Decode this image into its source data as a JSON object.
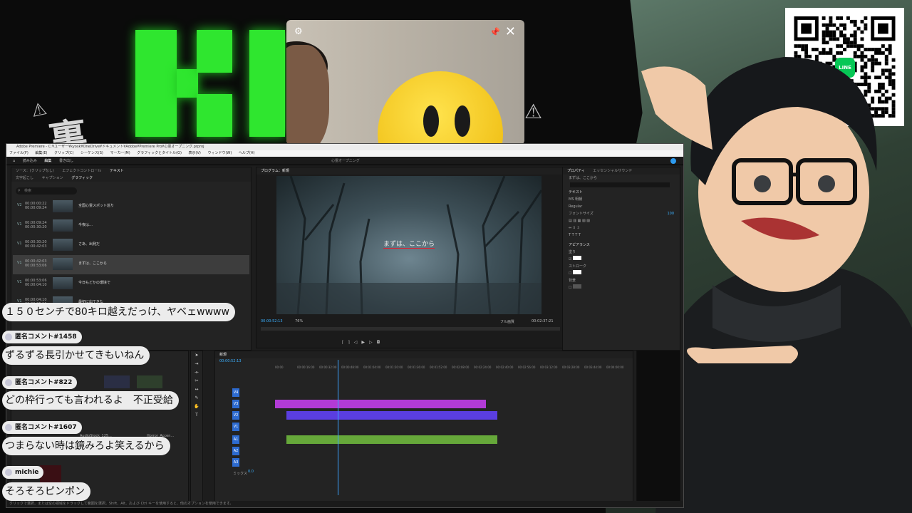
{
  "stream": {
    "green_logo_text": "KI",
    "kanji_text": "裏",
    "warning_glyph": "⚠",
    "qr_badge": "LINE"
  },
  "webcam": {
    "gear_icon": "gear-icon",
    "pin_icon": "pin-icon",
    "close_icon": "close-icon"
  },
  "premiere": {
    "title": "Adobe Premiere - C:¥ユーザー¥kyosk¥OneDrive¥ドキュメント¥Adobe¥Premiere Pro¥心霊オープニング.prproj",
    "menu": [
      "ファイル(F)",
      "編集(E)",
      "クリップ(C)",
      "シーケンス(S)",
      "マーカー(M)",
      "グラフィックとタイトル(G)",
      "表示(V)",
      "ウィンドウ(W)",
      "ヘルプ(H)"
    ],
    "workspace_tabs": [
      "読み込み",
      "編集",
      "書き出し"
    ],
    "sequence_title": "心霊オープニング",
    "left_tabs": [
      "ソース：(クリップなし)",
      "エフェクトコントロール",
      "テキスト"
    ],
    "left_subtabs": [
      "文字起こし",
      "キャプション",
      "グラフィック"
    ],
    "search_placeholder": "検索",
    "captions": [
      {
        "track": "V2",
        "tin": "00:00:00:22",
        "tout": "00:00:09:24",
        "text": "全国心霊スポット巡り"
      },
      {
        "track": "V1",
        "tin": "00:00:09:24",
        "tout": "00:00:30:20",
        "text": "今夜は…"
      },
      {
        "track": "V1",
        "tin": "00:00:30:20",
        "tout": "00:00:42:03",
        "text": "さあ、出発だ"
      },
      {
        "track": "V1",
        "tin": "00:00:42:03",
        "tout": "00:00:53:06",
        "text": "まずは、ここから"
      },
      {
        "track": "V1",
        "tin": "00:00:53:06",
        "tout": "00:00:04:10",
        "text": "今日もどかの環境で"
      },
      {
        "track": "V1",
        "tin": "00:00:04:10",
        "tout": "00:00:26:11",
        "text": "最初に出てきた"
      }
    ],
    "program": {
      "tab": "プログラム：新規",
      "caption": "まずは、ここから",
      "timecode": "00:00:52:13",
      "zoom": "76%",
      "quality": "フル画質",
      "duration": "00:02:37:21"
    },
    "properties": {
      "tabs": [
        "プロパティ",
        "エッセンシャルサウンド"
      ],
      "clip_name": "まずは、ここから",
      "section_text": "テキスト",
      "font": "MS 明朝",
      "style": "Regular",
      "size_label": "フォントサイズ",
      "size_value": "100",
      "section_appearance": "アピアランス",
      "fill": "塗り",
      "stroke": "ストローク",
      "shadow": "背景"
    },
    "timeline": {
      "tab": "新規",
      "timecode": "00:00:52:13",
      "ruler": [
        "00:00",
        "00:00:16:00",
        "00:00:32:00",
        "00:00:48:00",
        "00:01:04:00",
        "00:01:20:00",
        "00:01:36:00",
        "00:01:52:00",
        "00:02:08:00",
        "00:02:24:00",
        "00:02:40:00",
        "00:02:56:00",
        "00:03:12:00",
        "00:03:28:00",
        "00:03:44:00",
        "00:04:00:00"
      ],
      "tracks": [
        "V4",
        "V3",
        "V2",
        "V1",
        "A1",
        "A2",
        "A3",
        "ミックス"
      ],
      "mix_value": "0.0"
    },
    "project_items": [
      "AudioStock_125...",
      "Horror_Accen..."
    ],
    "status": "クリックで選択、または空の領域をドラッグして範囲を選択。Shift、Alt、および Ctrl キーを使用すると、他のオプションを使用できます。"
  },
  "chat": [
    {
      "type": "msg",
      "text": "１５０センチで80キロ越えだっけ、ヤベェwwww"
    },
    {
      "type": "user",
      "text": "匿名コメント#1458"
    },
    {
      "type": "msg",
      "text": "ずるずる長引かせてきもいねん"
    },
    {
      "type": "user",
      "text": "匿名コメント#822"
    },
    {
      "type": "msg",
      "text": "どの枠行っても言われるよ　不正受給"
    },
    {
      "type": "user",
      "text": "匿名コメント#1607"
    },
    {
      "type": "msg",
      "text": "つまらない時は鏡みろよ笑えるから"
    },
    {
      "type": "user",
      "text": "michie"
    },
    {
      "type": "msg",
      "text": "そろそろピンポン"
    }
  ],
  "colors": {
    "green_logo": "#2fe62f",
    "accent_blue": "#2d9bf0",
    "clip_magenta": "#b23bd6",
    "clip_blue": "#5a3ee0",
    "clip_green": "#66a83a",
    "line_green": "#06c755"
  }
}
